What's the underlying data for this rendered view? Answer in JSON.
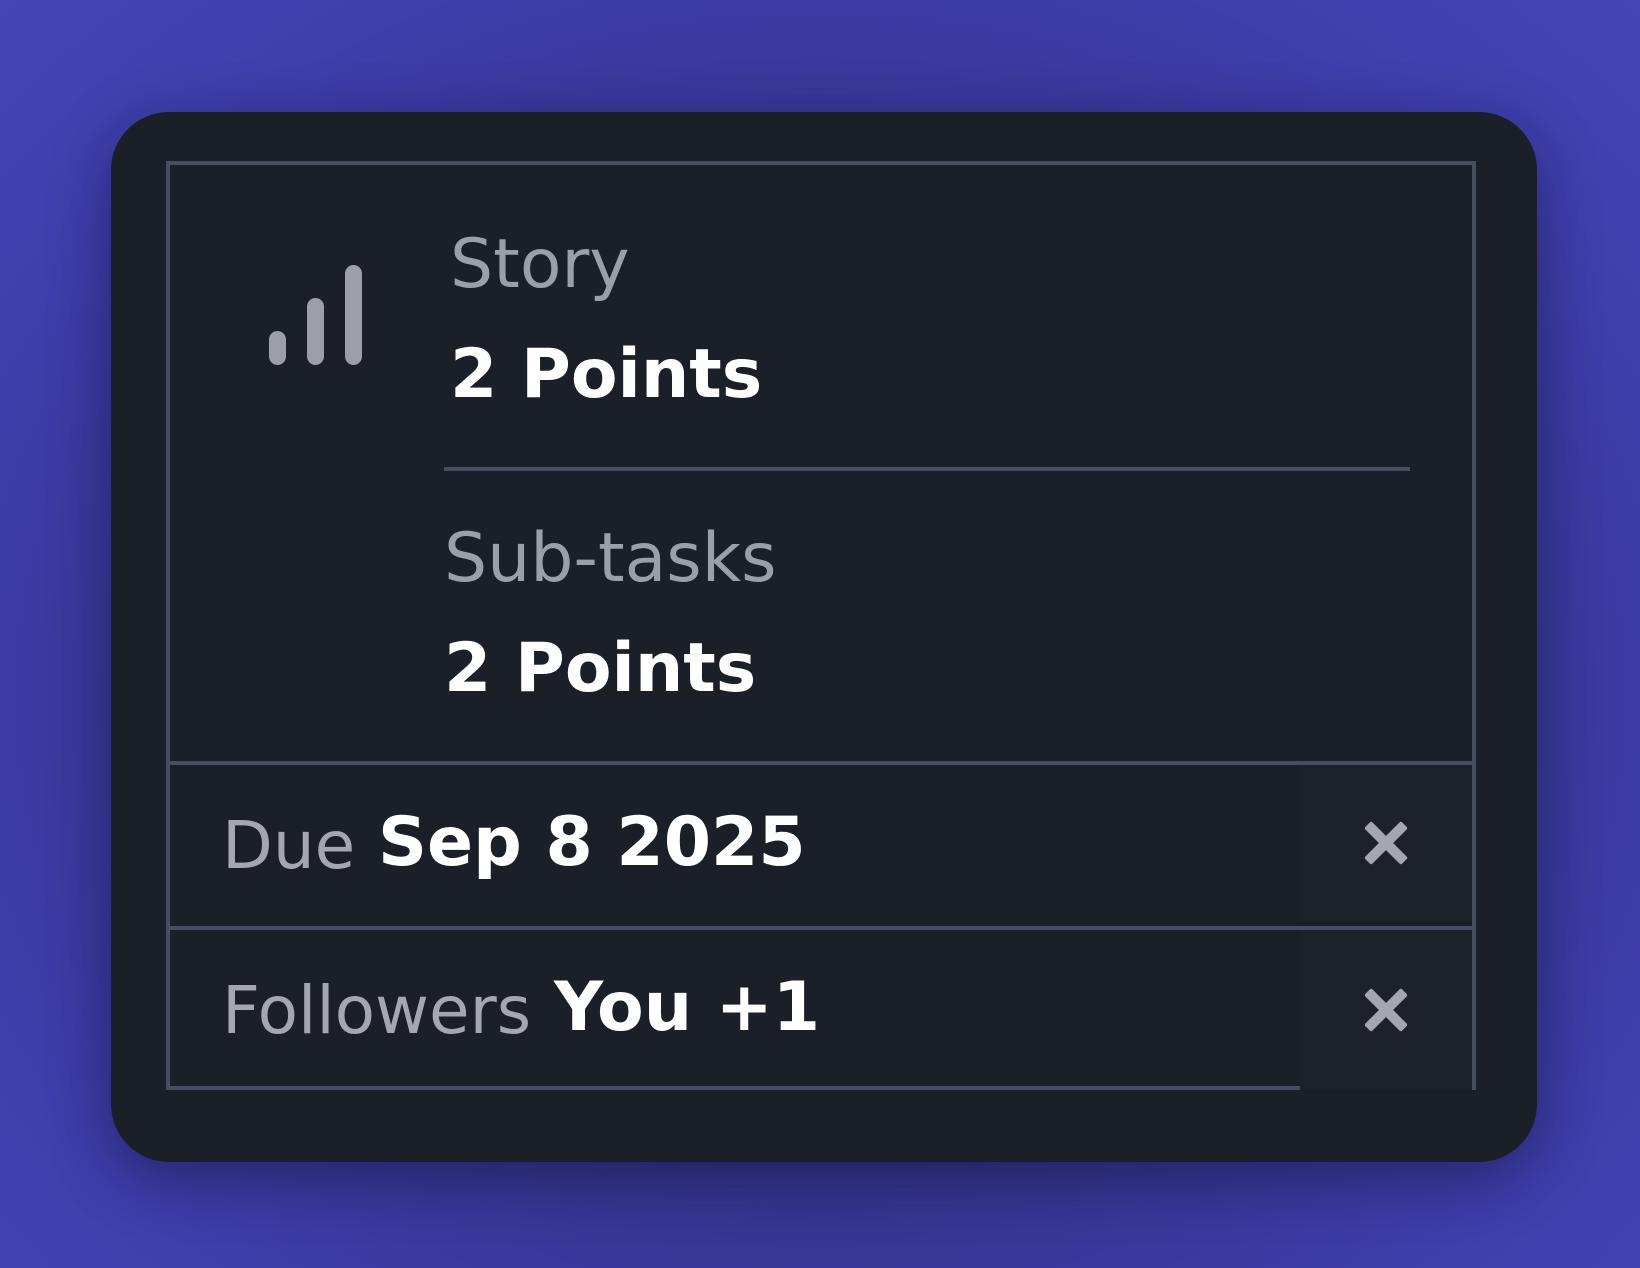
{
  "estimate": {
    "icon": "signal-bars-icon",
    "story": {
      "label": "Story",
      "value": "2 Points"
    },
    "subtasks": {
      "label": "Sub-tasks",
      "value": "2 Points"
    }
  },
  "fields": {
    "due": {
      "label": "Due",
      "value": "Sep 8 2025",
      "clear_icon": "close-icon"
    },
    "followers": {
      "label": "Followers",
      "value": "You +1",
      "clear_icon": "close-icon"
    }
  },
  "colors": {
    "card_background": "#1b1f27",
    "border": "#464e60",
    "label_text": "#9b9fa6",
    "value_text": "#ffffff",
    "page_background": "#3f3fae"
  }
}
